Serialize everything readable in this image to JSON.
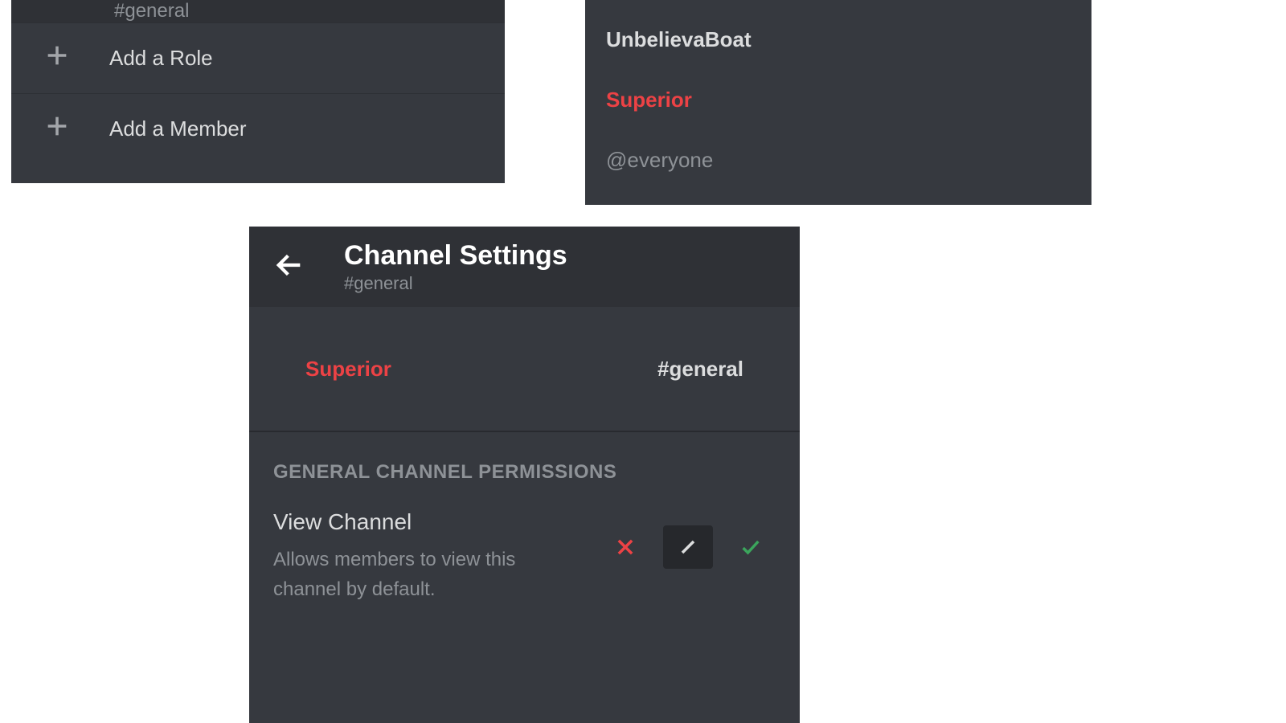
{
  "panel1": {
    "channel_label": "#general",
    "add_role_label": "Add a Role",
    "add_member_label": "Add a Member"
  },
  "panel2": {
    "items": [
      {
        "label": "UnbelievaBoat",
        "style": "normal"
      },
      {
        "label": "Superior",
        "style": "highlight"
      },
      {
        "label": "@everyone",
        "style": "muted"
      }
    ]
  },
  "panel3": {
    "title": "Channel Settings",
    "subtitle": "#general",
    "tabs": {
      "role": "Superior",
      "channel": "#general"
    },
    "section_header": "GENERAL CHANNEL PERMISSIONS",
    "permission": {
      "name": "View Channel",
      "description": "Allows members to view this channel by default."
    },
    "toggle_selected": "pass"
  }
}
